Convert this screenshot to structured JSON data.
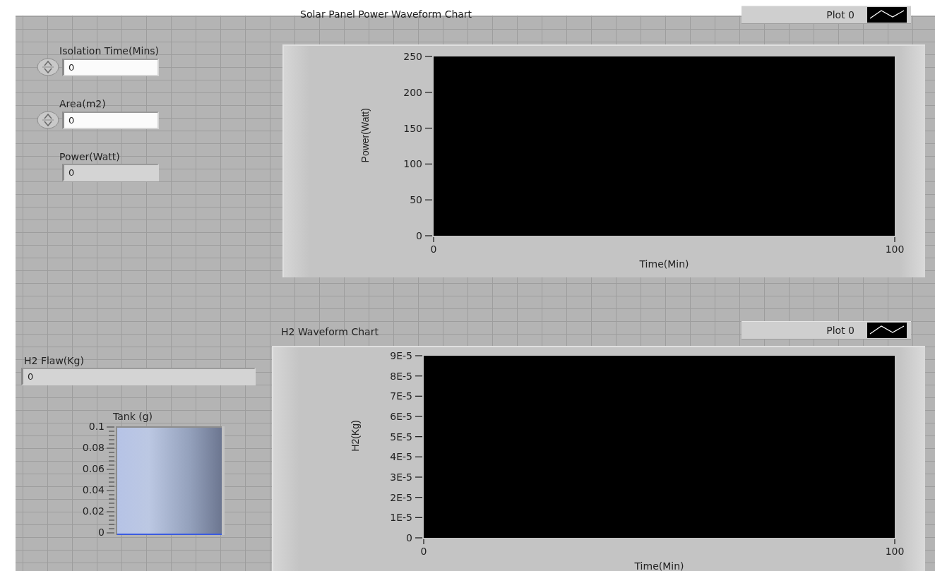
{
  "controls": [
    {
      "kind": "control",
      "label": "Isolation Time(Mins)",
      "value": "0"
    },
    {
      "kind": "control",
      "label": "Area(m2)",
      "value": "0"
    },
    {
      "kind": "indicator",
      "label": "Power(Watt)",
      "value": "0"
    }
  ],
  "charts": [
    {
      "title": "Solar Panel Power Waveform Chart",
      "xlabel": "Time(Min)",
      "ylabel": "Power(Watt)",
      "y_tick_labels": [
        "250",
        "200",
        "150",
        "100",
        "50",
        "0"
      ],
      "x_tick_labels": [
        "0",
        "100"
      ],
      "legend": [
        {
          "name": "Plot 0"
        }
      ]
    },
    {
      "title": "H2 Waveform Chart",
      "xlabel": "Time(Min)",
      "ylabel": "H2(Kg)",
      "y_tick_labels": [
        "9E-5",
        "8E-5",
        "7E-5",
        "6E-5",
        "5E-5",
        "4E-5",
        "3E-5",
        "2E-5",
        "1E-5",
        "0"
      ],
      "x_tick_labels": [
        "0",
        "100"
      ],
      "legend": [
        {
          "name": "Plot 0"
        }
      ]
    }
  ],
  "h2_flow": {
    "label": "H2 Flaw(Kg)",
    "value": "0"
  },
  "tank": {
    "label": "Tank  (g)",
    "scale": [
      "0.1",
      "0.08",
      "0.06",
      "0.04",
      "0.02",
      "0"
    ],
    "level": 0
  }
}
